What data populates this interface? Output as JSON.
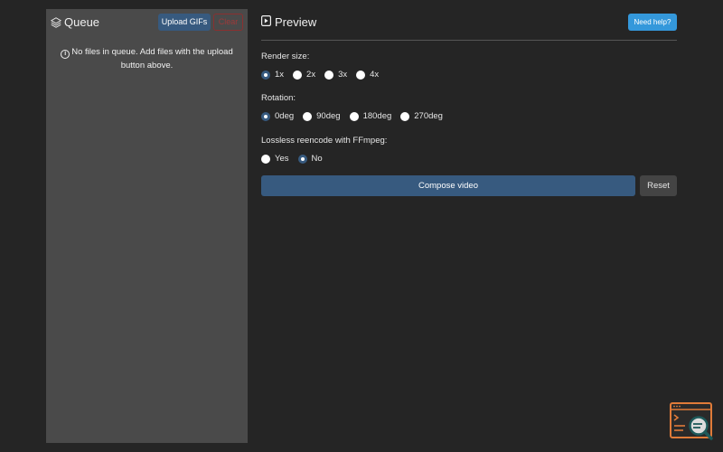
{
  "queue": {
    "title": "Queue",
    "upload_label": "Upload GIFs",
    "clear_label": "Clear",
    "empty_message": "No files in queue. Add files with the upload button above."
  },
  "preview": {
    "title": "Preview",
    "help_label": "Need help?"
  },
  "options": {
    "render_size": {
      "label": "Render size:",
      "choices": [
        "1x",
        "2x",
        "3x",
        "4x"
      ],
      "selected": "1x"
    },
    "rotation": {
      "label": "Rotation:",
      "choices": [
        "0deg",
        "90deg",
        "180deg",
        "270deg"
      ],
      "selected": "0deg"
    },
    "lossless": {
      "label": "Lossless reencode with FFmpeg:",
      "choices": [
        "Yes",
        "No"
      ],
      "selected": "No"
    }
  },
  "actions": {
    "compose_label": "Compose video",
    "reset_label": "Reset"
  },
  "colors": {
    "background": "#252525",
    "panel": "#4a4a4a",
    "primary": "#375a7f",
    "info": "#3498db",
    "danger": "#8a3030",
    "logo_accent": "#e07b39"
  },
  "icons": {
    "queue": "layers-icon",
    "preview": "play-square-icon",
    "info": "info-circle-icon",
    "corner": "terminal-search-logo-icon"
  }
}
